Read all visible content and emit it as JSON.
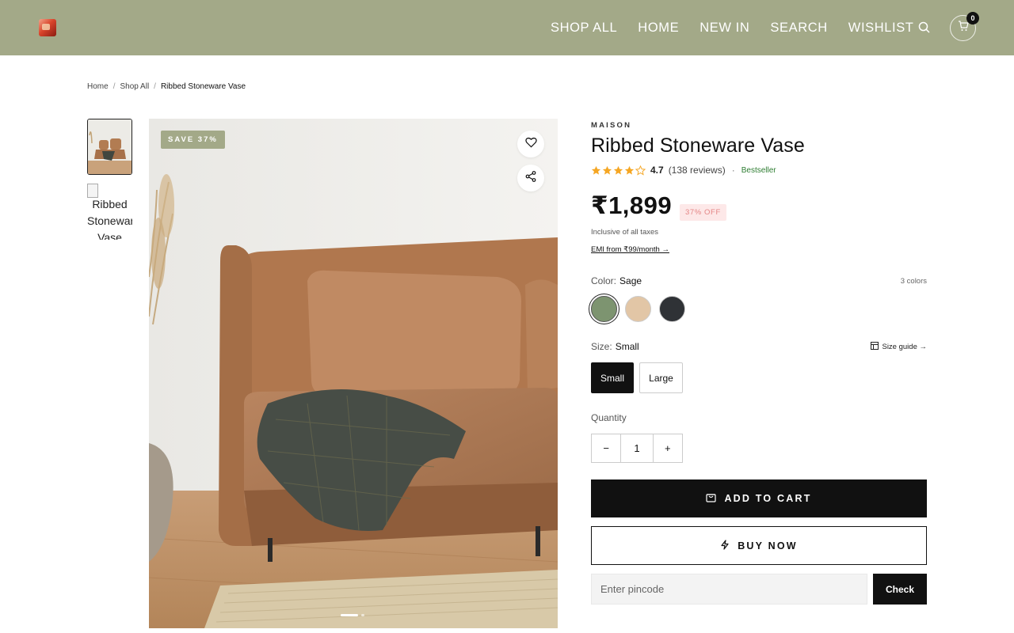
{
  "header": {
    "nav": [
      "SHOP ALL",
      "HOME",
      "NEW IN",
      "SEARCH",
      "WISHLIST"
    ],
    "cart_count": "0",
    "background": "#a3a988"
  },
  "breadcrumb": {
    "items": [
      "Home",
      "Shop All"
    ],
    "separator": "/",
    "current": "Ribbed Stoneware Vase"
  },
  "gallery": {
    "thumb2_alt": "Ribbed Stoneware Vase",
    "save_badge": "SAVE 37%"
  },
  "product": {
    "brand": "MAISON",
    "title": "Ribbed Stoneware Vase",
    "rating": {
      "stars_filled": 4,
      "stars_total": 5,
      "value": "4.7",
      "reviews": "(138 reviews)",
      "separator": "·",
      "badge": "Bestseller"
    },
    "price": "₹1,899",
    "discount_badge": "37% OFF",
    "tax_note": "Inclusive of all taxes",
    "emi": "EMI from ₹99/month →",
    "color": {
      "label": "Color:",
      "selected": "Sage",
      "count": "3 colors",
      "swatches": [
        "#7d9470",
        "#e2c6a6",
        "#2f3236"
      ]
    },
    "size": {
      "label": "Size:",
      "selected": "Small",
      "guide": "Size guide →",
      "options": [
        "Small",
        "Large"
      ]
    },
    "quantity": {
      "label": "Quantity",
      "minus": "−",
      "value": "1",
      "plus": "+"
    },
    "add_to_cart": "ADD TO CART",
    "buy_now": "BUY NOW",
    "pincode_placeholder": "Enter pincode",
    "check": "Check"
  }
}
